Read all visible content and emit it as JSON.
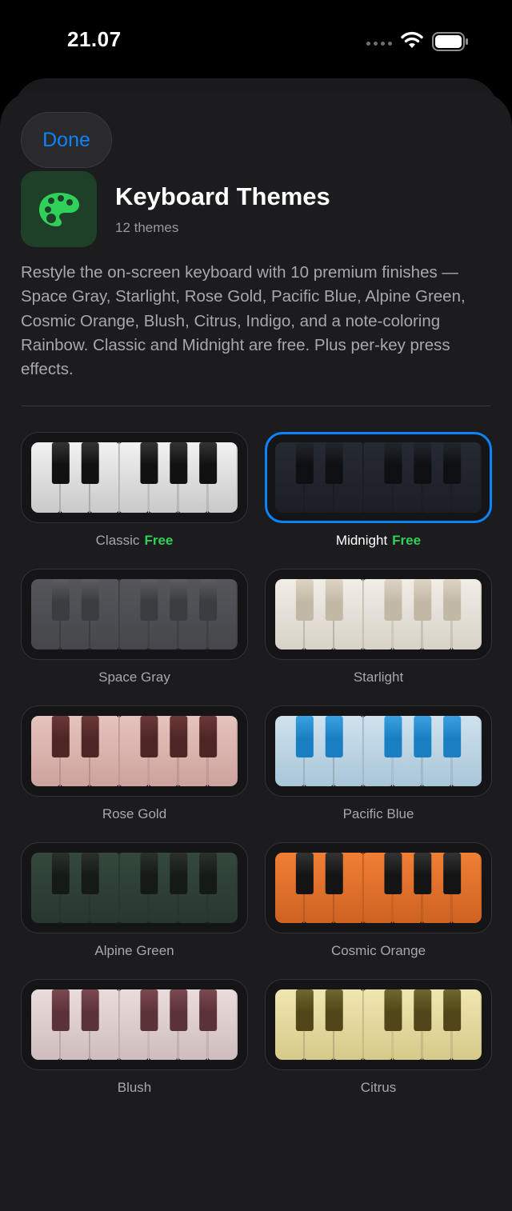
{
  "status": {
    "time": "21.07"
  },
  "header": {
    "done_label": "Done",
    "title": "Keyboard Themes",
    "subtitle": "12 themes",
    "description": "Restyle the on-screen keyboard with 10 premium finishes — Space Gray, Starlight, Rose Gold, Pacific Blue, Alpine Green, Cosmic Orange, Blush, Citrus, Indigo, and a note-coloring Rainbow. Classic and Midnight are free. Plus per-key press effects."
  },
  "colors": {
    "accent": "#0a84ff",
    "free": "#30d158",
    "icon_bg": "#1e4029",
    "icon_fg": "#30d158"
  },
  "themes": [
    {
      "name": "Classic",
      "badge": "Free",
      "selected": false,
      "white": "#f2f2f2",
      "white_edge": "#c9c9c9",
      "black": "#111111",
      "black_hi": "#333333",
      "lines": "#bdbdbd"
    },
    {
      "name": "Midnight",
      "badge": "Free",
      "selected": true,
      "white": "#262a33",
      "white_edge": "#1b1e25",
      "black": "#0d0f13",
      "black_hi": "#23262d",
      "lines": "#1a1d23"
    },
    {
      "name": "Space Gray",
      "badge": "",
      "selected": false,
      "white": "#55565b",
      "white_edge": "#46474c",
      "black": "#3b3c40",
      "black_hi": "#5c5d61",
      "lines": "#404145"
    },
    {
      "name": "Starlight",
      "badge": "",
      "selected": false,
      "white": "#f1ede6",
      "white_edge": "#d8d2c8",
      "black": "#c2b8a6",
      "black_hi": "#ddd4c5",
      "lines": "#cfc8bc"
    },
    {
      "name": "Rose Gold",
      "badge": "",
      "selected": false,
      "white": "#e6c3bd",
      "white_edge": "#cda39c",
      "black": "#4e2626",
      "black_hi": "#6b3838",
      "lines": "#c7a29b"
    },
    {
      "name": "Pacific Blue",
      "badge": "",
      "selected": false,
      "white": "#cfe2ee",
      "white_edge": "#a9c6d8",
      "black": "#1a7fc2",
      "black_hi": "#3aa1e0",
      "lines": "#a8c3d3"
    },
    {
      "name": "Alpine Green",
      "badge": "",
      "selected": false,
      "white": "#34483c",
      "white_edge": "#28382f",
      "black": "#151a16",
      "black_hi": "#2a312b",
      "lines": "#2a3a30"
    },
    {
      "name": "Cosmic Orange",
      "badge": "",
      "selected": false,
      "white": "#f07f35",
      "white_edge": "#cf6222",
      "black": "#141414",
      "black_hi": "#333333",
      "lines": "#c9631f"
    },
    {
      "name": "Blush",
      "badge": "",
      "selected": false,
      "white": "#eadcdc",
      "white_edge": "#cfbdbd",
      "black": "#5b3238",
      "black_hi": "#7a4a50",
      "lines": "#cbb8b8"
    },
    {
      "name": "Citrus",
      "badge": "",
      "selected": false,
      "white": "#f0e6b0",
      "white_edge": "#d6c98a",
      "black": "#504619",
      "black_hi": "#70662e",
      "lines": "#cfc28a"
    }
  ]
}
